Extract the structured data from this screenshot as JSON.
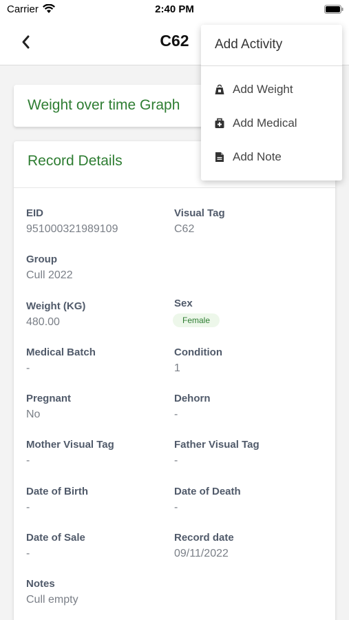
{
  "status_bar": {
    "carrier": "Carrier",
    "time": "2:40 PM"
  },
  "nav": {
    "title": "C62",
    "back_icon": "chevron-left-icon"
  },
  "graph_card": {
    "title": "Weight over time Graph"
  },
  "record_details": {
    "title": "Record Details",
    "rows": [
      [
        {
          "label": "EID",
          "value": "951000321989109"
        },
        {
          "label": "Visual Tag",
          "value": "C62"
        }
      ],
      [
        {
          "label": "Group",
          "value": "Cull 2022"
        }
      ],
      [
        {
          "label": "Weight (KG)",
          "value": "480.00"
        },
        {
          "label": "Sex",
          "badge": "Female"
        }
      ],
      [
        {
          "label": "Medical Batch",
          "value": "-"
        },
        {
          "label": "Condition",
          "value": "1"
        }
      ],
      [
        {
          "label": "Pregnant",
          "value": "No"
        },
        {
          "label": "Dehorn",
          "value": "-"
        }
      ],
      [
        {
          "label": "Mother Visual Tag",
          "value": "-"
        },
        {
          "label": "Father Visual Tag",
          "value": "-"
        }
      ],
      [
        {
          "label": "Date of Birth",
          "value": "-"
        },
        {
          "label": "Date of Death",
          "value": "-"
        }
      ],
      [
        {
          "label": "Date of Sale",
          "value": "-"
        },
        {
          "label": "Record date",
          "value": "09/11/2022"
        }
      ],
      [
        {
          "label": "Notes",
          "value": "Cull empty"
        }
      ]
    ]
  },
  "menu": {
    "title": "Add Activity",
    "items": [
      {
        "label": "Add Weight",
        "icon": "weight-icon"
      },
      {
        "label": "Add Medical",
        "icon": "medical-bag-icon"
      },
      {
        "label": "Add Note",
        "icon": "note-icon"
      }
    ]
  },
  "colors": {
    "accent_green": "#2e7d32",
    "badge_bg": "#edf7ea",
    "label": "#505a6a",
    "value": "#7a7f87"
  }
}
